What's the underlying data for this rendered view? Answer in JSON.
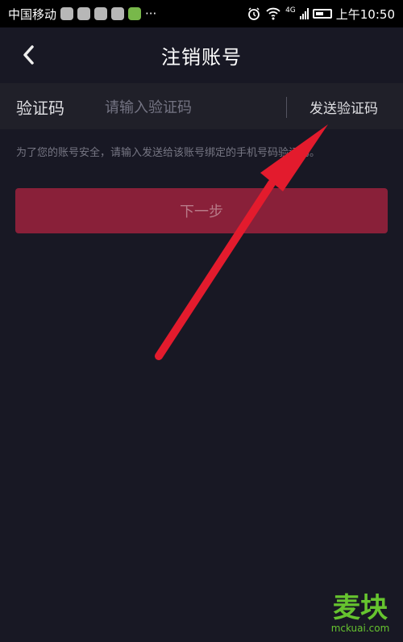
{
  "status_bar": {
    "carrier": "中国移动",
    "more": "···",
    "network": "4G",
    "time": "上午10:50"
  },
  "header": {
    "title": "注销账号",
    "back_icon": "chevron-left-icon"
  },
  "verification": {
    "label": "验证码",
    "placeholder": "请输入验证码",
    "send_button": "发送验证码"
  },
  "help_text": "为了您的账号安全，请输入发送给该账号绑定的手机号码验证码。",
  "next_button": "下一步",
  "watermark": {
    "text": "麦块",
    "domain": "mckuai.com"
  },
  "colors": {
    "background": "#181824",
    "input_background": "#202029",
    "button": "#892039",
    "annotation_arrow": "#e31b2d",
    "watermark": "#66c42f"
  },
  "icons": [
    "alarm-icon",
    "wifi-icon",
    "signal-icon",
    "battery-icon",
    "chevron-left-icon",
    "red-arrow-annotation"
  ]
}
